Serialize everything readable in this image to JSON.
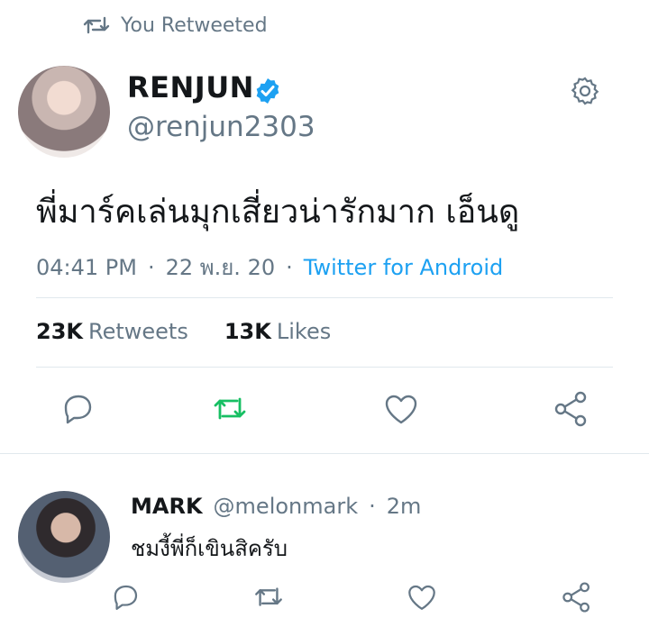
{
  "retweet_context": {
    "text": "You Retweeted",
    "icon": "retweet-icon"
  },
  "tweet": {
    "name": "RENJUN",
    "handle": "@renjun2303",
    "text": "พี่มาร์คเล่นมุกเสี่ยวน่ารักมาก เอ็นดู",
    "time": "04:41 PM",
    "dot1": "·",
    "date": "22 พ.ย. 20",
    "dot2": "·",
    "source": "Twitter for Android",
    "retweets_count": "23K",
    "retweets_label": "Retweets",
    "likes_count": "13K",
    "likes_label": "Likes"
  },
  "reply": {
    "name": "MARK",
    "handle": "@melonmark",
    "dot": "·",
    "time": "2m",
    "text": "ชมงี้พี่ก็เขินสิครับ"
  },
  "colors": {
    "accent": "#1da1f2",
    "retweet_active": "#17bf63",
    "muted": "#657786",
    "divider": "#e1e8ed"
  }
}
